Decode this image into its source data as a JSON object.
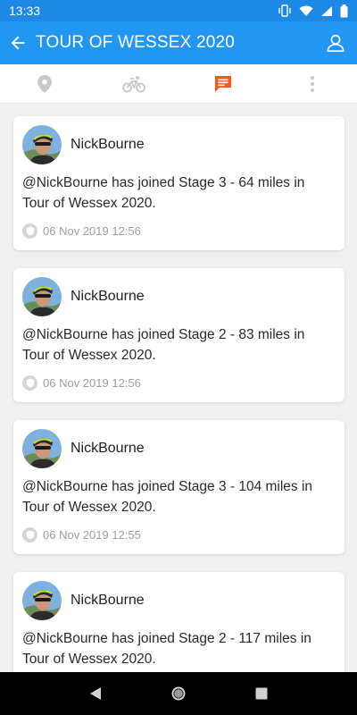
{
  "status_bar": {
    "time": "13:33"
  },
  "header": {
    "title": "TOUR OF WESSEX 2020"
  },
  "tabs": [
    {
      "icon": "location-pin-icon",
      "active": false
    },
    {
      "icon": "bicycle-icon",
      "active": false
    },
    {
      "icon": "chat-message-icon",
      "active": true
    },
    {
      "icon": "more-vertical-icon",
      "active": false
    }
  ],
  "colors": {
    "primary": "#2196f3",
    "status_bar": "#1e88e5",
    "accent": "#ff5722",
    "inactive_icon": "#c8c8c8"
  },
  "feed": {
    "items": [
      {
        "user": "NickBourne",
        "text": "@NickBourne has joined Stage 3 - 64 miles in Tour of Wessex 2020.",
        "time": "06 Nov 2019 12:56"
      },
      {
        "user": "NickBourne",
        "text": "@NickBourne has joined Stage 2 - 83 miles in Tour of Wessex 2020.",
        "time": "06 Nov 2019 12:56"
      },
      {
        "user": "NickBourne",
        "text": "@NickBourne has joined Stage 3 - 104 miles in Tour of Wessex 2020.",
        "time": "06 Nov 2019 12:55"
      },
      {
        "user": "NickBourne",
        "text": "@NickBourne has joined Stage 2 - 117 miles in Tour of Wessex 2020.",
        "time": ""
      }
    ]
  }
}
